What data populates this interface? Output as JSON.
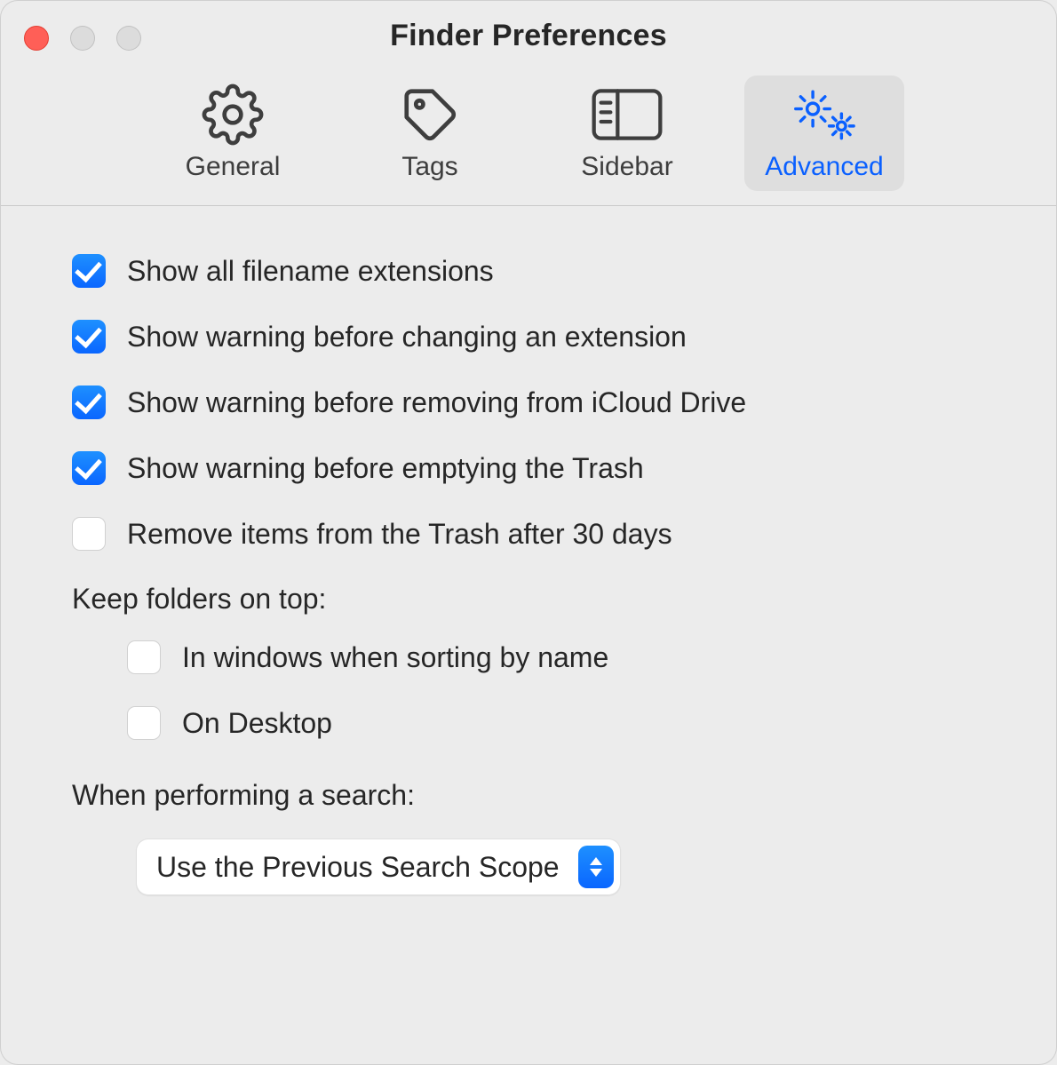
{
  "window": {
    "title": "Finder Preferences"
  },
  "toolbar": {
    "tabs": [
      {
        "label": "General",
        "active": false,
        "icon": "gear-icon"
      },
      {
        "label": "Tags",
        "active": false,
        "icon": "tag-icon"
      },
      {
        "label": "Sidebar",
        "active": false,
        "icon": "sidebar-icon"
      },
      {
        "label": "Advanced",
        "active": true,
        "icon": "gears-icon"
      }
    ]
  },
  "options": [
    {
      "label": "Show all filename extensions",
      "checked": true
    },
    {
      "label": "Show warning before changing an extension",
      "checked": true
    },
    {
      "label": "Show warning before removing from iCloud Drive",
      "checked": true
    },
    {
      "label": "Show warning before emptying the Trash",
      "checked": true
    },
    {
      "label": "Remove items from the Trash after 30 days",
      "checked": false
    }
  ],
  "keep_folders": {
    "heading": "Keep folders on top:",
    "items": [
      {
        "label": "In windows when sorting by name",
        "checked": false
      },
      {
        "label": "On Desktop",
        "checked": false
      }
    ]
  },
  "search": {
    "heading": "When performing a search:",
    "selected": "Use the Previous Search Scope"
  }
}
